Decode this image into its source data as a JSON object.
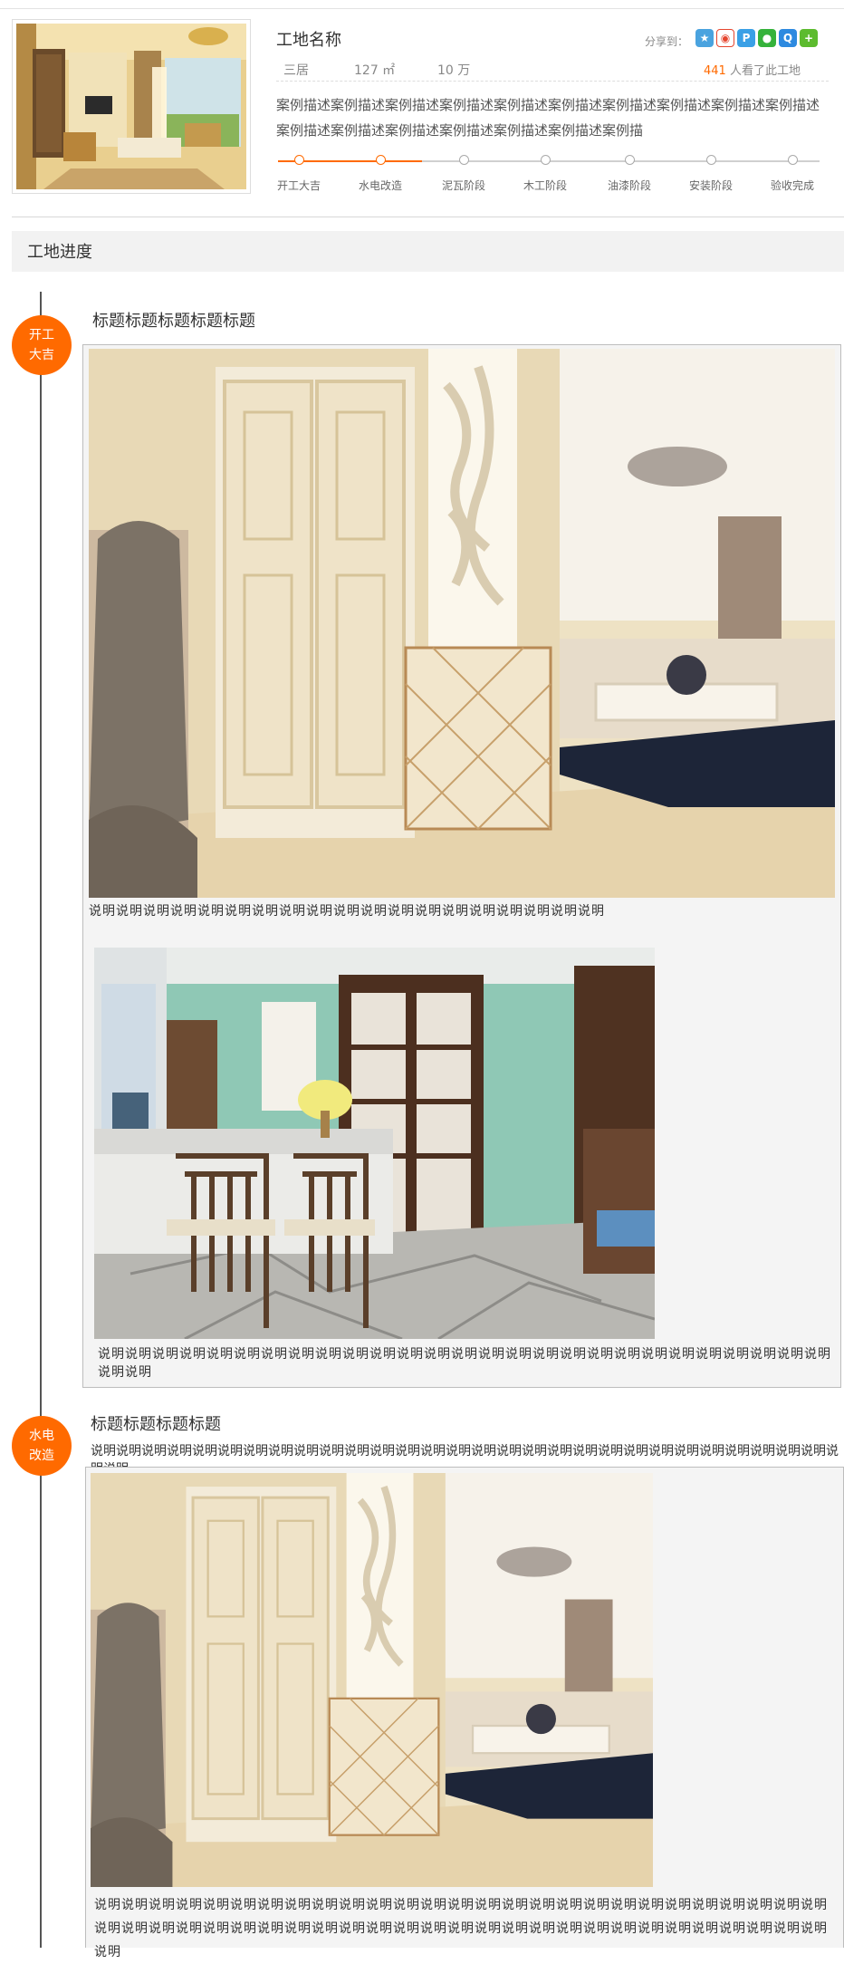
{
  "header": {
    "site_name": "工地名称",
    "share_label": "分享到：",
    "share_icons": [
      "qzone-icon",
      "weibo-icon",
      "pengyou-icon",
      "wechat-icon",
      "qq-icon",
      "more-share-icon"
    ],
    "layout": "三居",
    "area": "127 ㎡",
    "budget": "10 万",
    "views_count": "441",
    "views_suffix": " 人看了此工地",
    "description": "案例描述案例描述案例描述案例描述案例描述案例描述案例描述案例描述案例描述案例描述案例描述案例描述案例描述案例描述案例描述案例描述案例描",
    "stages": [
      "开工大吉",
      "水电改造",
      "泥瓦阶段",
      "木工阶段",
      "油漆阶段",
      "安装阶段",
      "验收完成"
    ],
    "progress_completed_stages": 2,
    "accent_color": "#ff6a00"
  },
  "progress_section": {
    "title": "工地进度"
  },
  "timeline": [
    {
      "badge": [
        "开工",
        "大吉"
      ],
      "title": "标题标题标题标题标题",
      "photos": [
        {
          "caption": "说明说明说明说明说明说明说明说明说明说明说明说明说明说明说明说明说明说明说明"
        },
        {
          "caption": "说明说明说明说明说明说明说明说明说明说明说明说明说明说明说明说明说明说明说明说明说明说明说明说明说明说明说明说明说明"
        }
      ]
    },
    {
      "badge": [
        "水电",
        "改造"
      ],
      "title": "标题标题标题标题",
      "subtitle": "说明说明说明说明说明说明说明说明说明说明说明说明说明说明说明说明说明说明说明说明说明说明说明说明说明说明说明说明说明说明说明",
      "photos": [
        {
          "caption": "说明说明说明说明说明说明说明说明说明说明说明说明说明说明说明说明说明说明说明说明说明说明说明说明说明说明说明说明说明说明说明说明说明说明说明说明说明说明说明说明说明说明说明说明说明说明说明说明说明说明说明说明说明说明说明"
        }
      ]
    }
  ]
}
